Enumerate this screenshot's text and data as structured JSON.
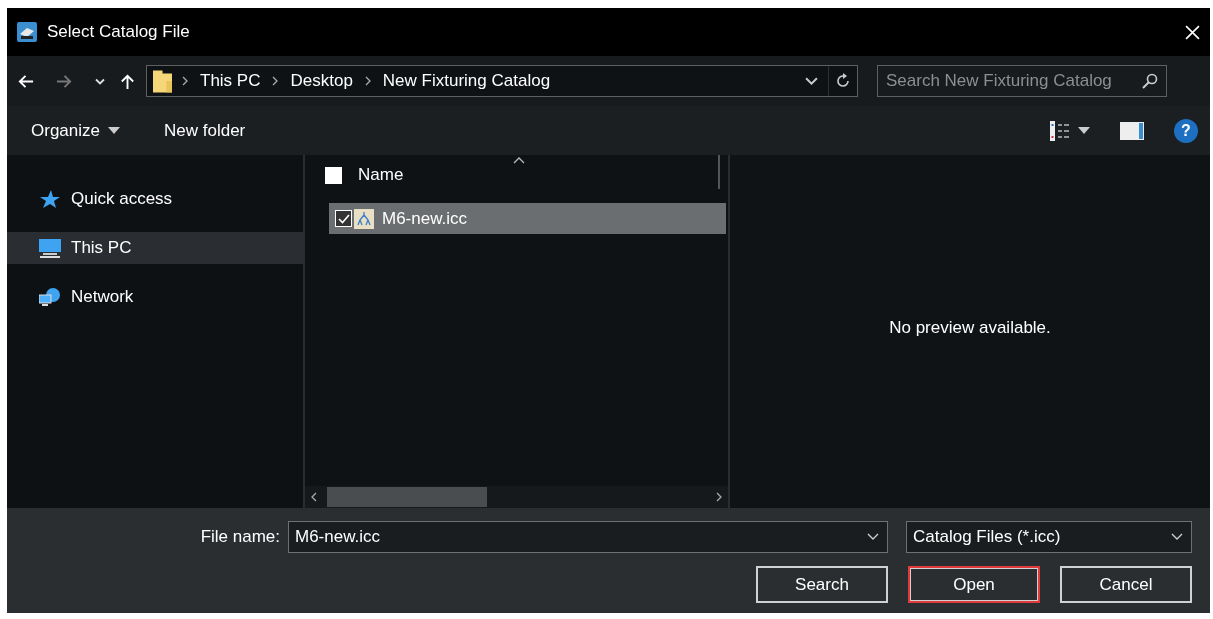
{
  "window": {
    "title": "Select Catalog File"
  },
  "navigation": {
    "back_disabled": false,
    "forward_disabled": true,
    "breadcrumb": [
      "This PC",
      "Desktop",
      "New Fixturing Catalog"
    ]
  },
  "search": {
    "placeholder": "Search New Fixturing Catalog"
  },
  "toolbar": {
    "organize": "Organize",
    "new_folder": "New folder",
    "help": "?"
  },
  "sidebar": {
    "items": [
      {
        "label": "Quick access",
        "kind": "star",
        "selected": false
      },
      {
        "label": "This PC",
        "kind": "computer",
        "selected": true
      },
      {
        "label": "Network",
        "kind": "network",
        "selected": false
      }
    ]
  },
  "file_list": {
    "header": {
      "label": "Name",
      "checked": false
    },
    "rows": [
      {
        "name": "M6-new.icc",
        "checked": true,
        "selected": true
      }
    ]
  },
  "preview": {
    "message": "No preview available."
  },
  "footer": {
    "file_name_label": "File name:",
    "file_name": "M6-new.icc",
    "file_type": "Catalog Files (*.icc)",
    "buttons": [
      {
        "label": "Search",
        "selected": false
      },
      {
        "label": "Open",
        "selected": true
      },
      {
        "label": "Cancel",
        "selected": false
      }
    ]
  }
}
